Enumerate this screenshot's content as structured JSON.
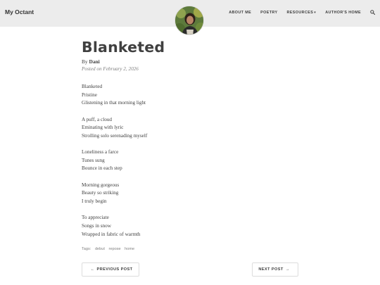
{
  "navbar": {
    "brand": "My Octant",
    "items": [
      {
        "label": "ABOUT ME"
      },
      {
        "label": "POETRY"
      },
      {
        "label": "RESOURCES"
      },
      {
        "label": "AUTHOR'S HOME"
      }
    ],
    "resources_caret": "▾",
    "search_icon": "search-icon"
  },
  "post": {
    "title": "Blanketed",
    "by_prefix": "By",
    "author": "Dani",
    "posted": "Posted on February 2, 2026",
    "stanzas": [
      [
        "Blanketed",
        "Pristine",
        "Glistening in that morning light"
      ],
      [
        "A puff, a cloud",
        "Eminating with lyric",
        "Strolling solo serenading myself"
      ],
      [
        "Loneliness a farce",
        "Tunes sung",
        "Bounce in each step"
      ],
      [
        "Morning gorgeous",
        "Beauty so striking",
        "I truly begin"
      ],
      [
        "To appreciate",
        "Songs in snow",
        "Wrapped in fabric of warmth"
      ]
    ],
    "tags_label": "Tags:",
    "tags": [
      "debut",
      "repose",
      "home"
    ]
  },
  "pager": {
    "prev_arrow": "←",
    "prev_label": "PREVIOUS POST",
    "next_label": "NEXT POST",
    "next_arrow": "→"
  },
  "colors": {
    "navbar_bg": "#ececec",
    "text": "#404040",
    "muted": "#808080"
  }
}
